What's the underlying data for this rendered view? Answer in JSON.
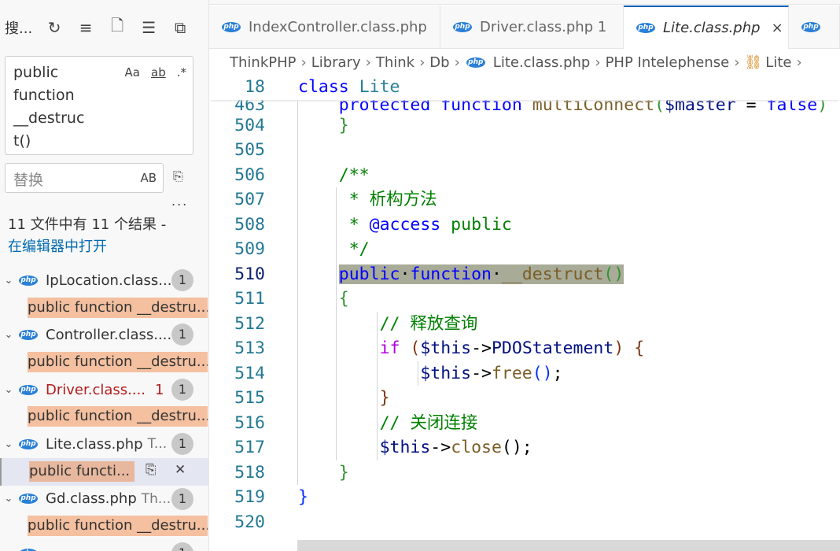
{
  "sidebar": {
    "title": "搜...",
    "toolbar_icons": [
      "refresh-icon",
      "clear-results-icon",
      "new-search-editor-icon",
      "collapse-all-icon",
      "view-as-tree-icon"
    ],
    "search_value": "public function __destruct()",
    "search_lines": [
      "public",
      "function",
      "__destruc",
      "t()"
    ],
    "match_case": "Aa",
    "whole_word": "ab",
    "regex": ".*",
    "replace_placeholder": "替换",
    "preserve_case": "AB",
    "more": "...",
    "summary": "11 文件中有 11 个结果 -",
    "open_in_editor": "在编辑器中打开",
    "results": [
      {
        "file": "IpLocation.class....",
        "desc": "",
        "count": "1",
        "error": "",
        "match": "public function __destru..."
      },
      {
        "file": "Controller.class....",
        "desc": "",
        "count": "1",
        "error": "",
        "match": "public function __destru..."
      },
      {
        "file": "Driver.class....",
        "desc": "",
        "count": "1",
        "error": "1",
        "match": "public function __destru..."
      },
      {
        "file": "Lite.class.php",
        "desc": "T...",
        "count": "1",
        "error": "",
        "match": "public functi...",
        "selected": true
      },
      {
        "file": "Gd.class.php",
        "desc": "Th...",
        "count": "1",
        "error": "",
        "match": "public function __destru..."
      },
      {
        "file": "",
        "desc": "",
        "count": "1",
        "error": "",
        "match": ""
      }
    ]
  },
  "tabs": [
    {
      "label": "IndexController.class.php",
      "state": "normal"
    },
    {
      "label": "Driver.class.php 1",
      "state": "error"
    },
    {
      "label": "Lite.class.php",
      "state": "active",
      "close": "×"
    }
  ],
  "breadcrumbs": [
    "ThinkPHP",
    "Library",
    "Think",
    "Db",
    "Lite.class.php",
    "PHP Intelephense",
    "Lite"
  ],
  "editor": {
    "sticky": {
      "num": "18",
      "tokens": [
        [
          "class",
          "k"
        ],
        [
          " ",
          ""
        ],
        [
          "Lite",
          "t"
        ]
      ]
    },
    "sticky2": {
      "num": "463",
      "tokens": [
        [
          "    ",
          ""
        ],
        [
          "protected",
          "k"
        ],
        [
          " ",
          ""
        ],
        [
          "function",
          "k"
        ],
        [
          " ",
          ""
        ],
        [
          "multiConnect",
          "fn"
        ],
        [
          "(",
          "p0"
        ],
        [
          "$master",
          "v"
        ],
        [
          " = ",
          "tx"
        ],
        [
          "false",
          "k"
        ],
        [
          ")",
          "p0"
        ]
      ]
    },
    "current_line": "510",
    "lines": [
      {
        "num": "504",
        "tokens": [
          [
            "    ",
            ""
          ],
          [
            "}",
            "p0"
          ]
        ]
      },
      {
        "num": "505",
        "tokens": []
      },
      {
        "num": "506",
        "tokens": [
          [
            "    ",
            ""
          ],
          [
            "/**",
            "c"
          ]
        ]
      },
      {
        "num": "507",
        "tokens": [
          [
            "     ",
            ""
          ],
          [
            "* 析构方法",
            "c"
          ]
        ]
      },
      {
        "num": "508",
        "tokens": [
          [
            "     ",
            ""
          ],
          [
            "* ",
            "c"
          ],
          [
            "@access",
            "k"
          ],
          [
            " public",
            "c"
          ]
        ]
      },
      {
        "num": "509",
        "tokens": [
          [
            "     ",
            ""
          ],
          [
            "*/",
            "c"
          ]
        ]
      },
      {
        "num": "510",
        "tokens": [
          [
            "    ",
            ""
          ],
          [
            "public",
            "k hl"
          ],
          [
            "·",
            "hl tx"
          ],
          [
            "function",
            "k hl"
          ],
          [
            "·",
            "hl tx"
          ],
          [
            "__destruct",
            "fn hl"
          ],
          [
            "()",
            "p0 hl"
          ]
        ]
      },
      {
        "num": "511",
        "tokens": [
          [
            "    ",
            ""
          ],
          [
            "{",
            "p0"
          ]
        ]
      },
      {
        "num": "512",
        "tokens": [
          [
            "        ",
            ""
          ],
          [
            "// 释放查询",
            "c"
          ]
        ]
      },
      {
        "num": "513",
        "tokens": [
          [
            "        ",
            ""
          ],
          [
            "if",
            "kw"
          ],
          [
            " ",
            ""
          ],
          [
            "(",
            "p1"
          ],
          [
            "$this",
            "v"
          ],
          [
            "->",
            "tx"
          ],
          [
            "PDOStatement",
            "v"
          ],
          [
            ")",
            "p1"
          ],
          [
            " ",
            ""
          ],
          [
            "{",
            "p1"
          ]
        ]
      },
      {
        "num": "514",
        "tokens": [
          [
            "            ",
            ""
          ],
          [
            "$this",
            "v"
          ],
          [
            "->",
            "tx"
          ],
          [
            "free",
            "fn"
          ],
          [
            "()",
            "p2"
          ],
          [
            ";",
            "tx"
          ]
        ]
      },
      {
        "num": "515",
        "tokens": [
          [
            "        ",
            ""
          ],
          [
            "}",
            "p1"
          ]
        ]
      },
      {
        "num": "516",
        "tokens": [
          [
            "        ",
            ""
          ],
          [
            "// 关闭连接",
            "c"
          ]
        ]
      },
      {
        "num": "517",
        "tokens": [
          [
            "        ",
            ""
          ],
          [
            "$this",
            "v"
          ],
          [
            "->",
            "tx"
          ],
          [
            "close",
            "fn"
          ],
          [
            "();",
            "tx"
          ]
        ]
      },
      {
        "num": "518",
        "tokens": [
          [
            "    ",
            ""
          ],
          [
            "}",
            "p0"
          ]
        ]
      },
      {
        "num": "519",
        "tokens": [
          [
            "}",
            "p2"
          ]
        ]
      },
      {
        "num": "520",
        "tokens": []
      }
    ]
  },
  "colors": {
    "accent": "#005fb8",
    "match_bg": "#f4c0a0",
    "error": "#b31b1b",
    "selection_highlight": "#a8ab98"
  }
}
